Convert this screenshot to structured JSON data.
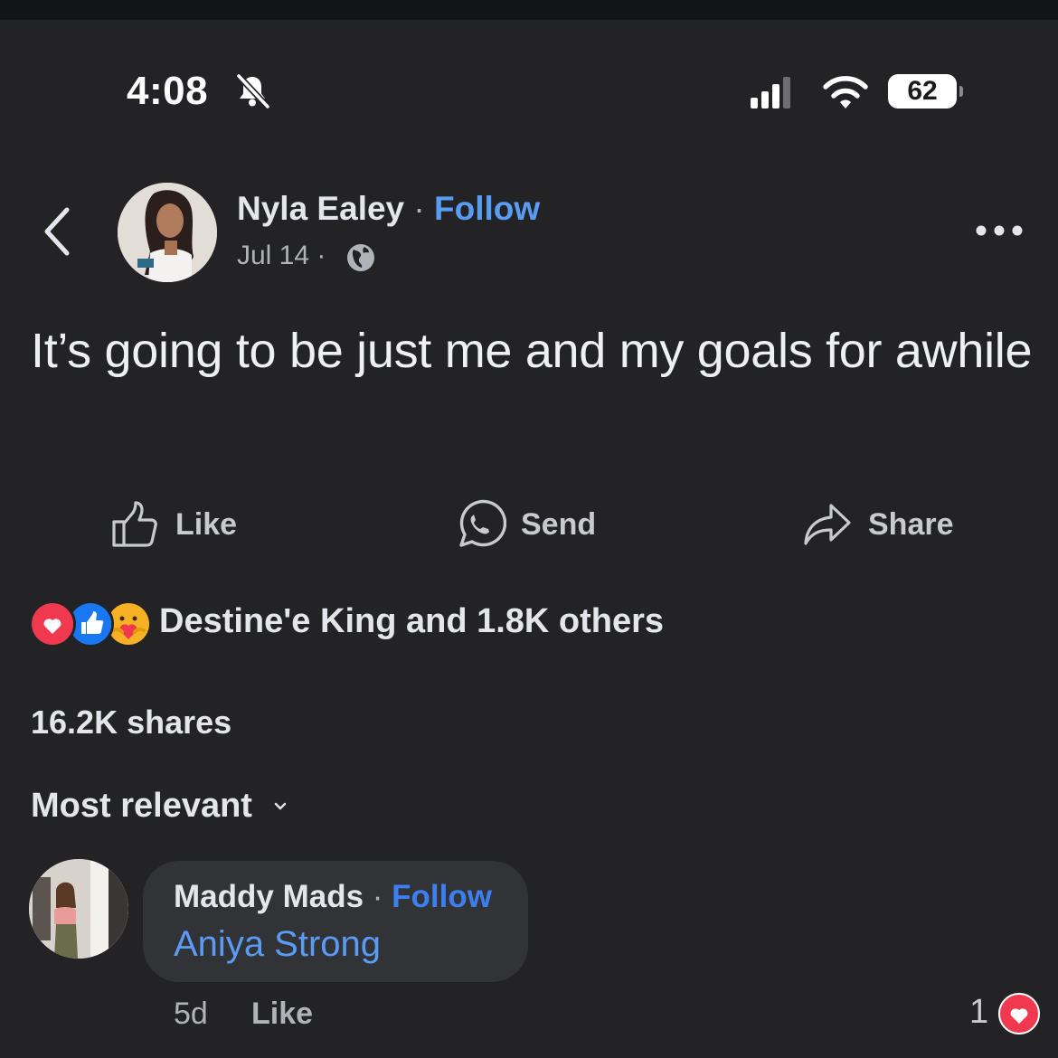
{
  "status_bar": {
    "time": "4:08",
    "battery": "62",
    "icons": [
      "bell-slash-icon",
      "cellular-signal-icon",
      "wifi-icon",
      "battery-icon"
    ]
  },
  "post": {
    "author": "Nyla Ealey",
    "separator": "·",
    "follow_label": "Follow",
    "date": "Jul 14",
    "visibility_icon": "globe-icon",
    "text": "It’s going to be just me and my goals for awhile"
  },
  "actions": {
    "like": "Like",
    "send": "Send",
    "share": "Share"
  },
  "reactions": {
    "icons": [
      "love-reaction-icon",
      "like-reaction-icon",
      "care-reaction-icon"
    ],
    "summary": "Destine'e King and 1.8K others"
  },
  "shares": "16.2K shares",
  "comments": {
    "sort_label": "Most relevant",
    "items": [
      {
        "author": "Maddy Mads",
        "separator": "·",
        "follow_label": "Follow",
        "text": "Aniya Strong",
        "time": "5d",
        "like_label": "Like",
        "reaction_count": "1",
        "reaction_icon": "love-reaction-icon"
      }
    ]
  },
  "colors": {
    "background": "#232326",
    "link_blue": "#5b9cf3",
    "love_red": "#f0394f",
    "like_blue": "#1877f2"
  }
}
